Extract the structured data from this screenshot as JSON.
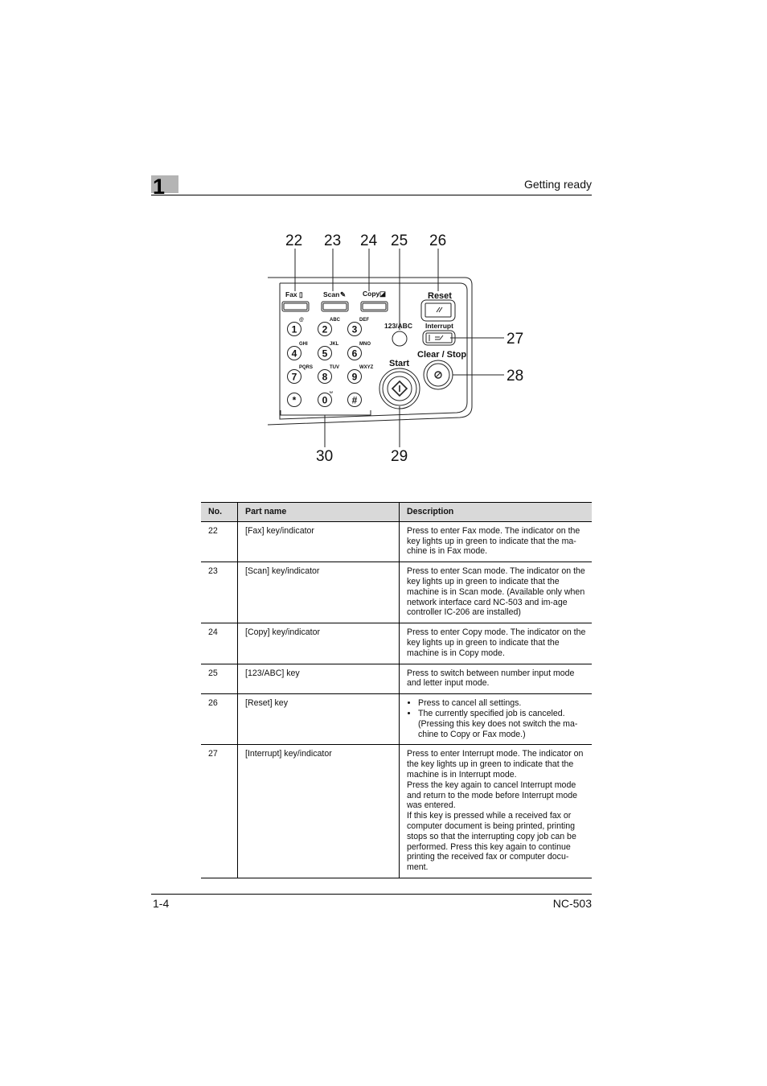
{
  "header": {
    "chapter_number": "1",
    "section_title": "Getting ready"
  },
  "diagram": {
    "callouts": [
      "22",
      "23",
      "24",
      "25",
      "26",
      "27",
      "28",
      "29",
      "30"
    ],
    "keys": {
      "fax": "Fax",
      "scan": "Scan",
      "copy": "Copy",
      "reset": "Reset",
      "interrupt": "Interrupt",
      "mode_switch": "123/ABC",
      "start": "Start",
      "clear_stop": "Clear / Stop"
    },
    "keypad": [
      {
        "digit": "1",
        "letters": "@"
      },
      {
        "digit": "2",
        "letters": "ABC"
      },
      {
        "digit": "3",
        "letters": "DEF"
      },
      {
        "digit": "4",
        "letters": "GHI"
      },
      {
        "digit": "5",
        "letters": "JKL"
      },
      {
        "digit": "6",
        "letters": "MNO"
      },
      {
        "digit": "7",
        "letters": "PQRS"
      },
      {
        "digit": "8",
        "letters": "TUV"
      },
      {
        "digit": "9",
        "letters": "WXYZ"
      },
      {
        "digit": "*",
        "letters": ""
      },
      {
        "digit": "0",
        "letters": "␣"
      },
      {
        "digit": "#",
        "letters": ""
      }
    ]
  },
  "table": {
    "headers": [
      "No.",
      "Part name",
      "Description"
    ],
    "rows": [
      {
        "no": "22",
        "name": "[Fax] key/indicator",
        "desc": "Press to enter Fax mode. The indicator on the key lights up in green to indicate that the ma-chine is in Fax mode."
      },
      {
        "no": "23",
        "name": "[Scan] key/indicator",
        "desc": "Press to enter Scan mode. The indicator on the key lights up in green to indicate that the machine is in Scan mode. (Available only when network interface card NC-503 and im-age controller IC-206 are installed)"
      },
      {
        "no": "24",
        "name": "[Copy] key/indicator",
        "desc": "Press to enter Copy mode. The indicator on the key lights up in green to indicate that the machine is in Copy mode."
      },
      {
        "no": "25",
        "name": "[123/ABC] key",
        "desc": "Press to switch between number input mode and letter input mode."
      },
      {
        "no": "26",
        "name": "[Reset] key",
        "bullets": [
          "Press to cancel all settings.",
          "The currently specified job is canceled. (Pressing this key does not switch the ma-chine to Copy or Fax mode.)"
        ]
      },
      {
        "no": "27",
        "name": "[Interrupt] key/indicator",
        "desc_lines": [
          "Press to enter Interrupt mode. The indicator on the key lights up in green to indicate that the machine is in Interrupt mode.",
          "Press the key again to cancel Interrupt mode and return to the mode before Interrupt mode was entered.",
          "If this key is pressed while a received fax or computer document is being printed, printing stops so that the interrupting copy job can be performed. Press this key again to continue printing the received fax or computer docu-ment."
        ]
      }
    ]
  },
  "footer": {
    "page_number": "1-4",
    "product": "NC-503"
  }
}
